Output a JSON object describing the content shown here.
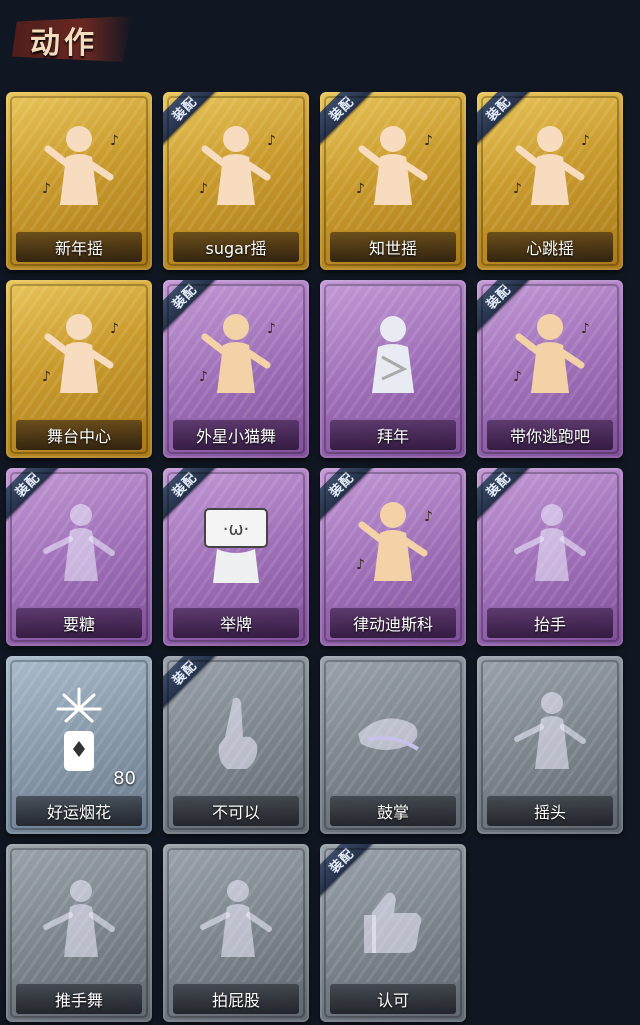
{
  "header": {
    "title": "动作"
  },
  "equip_label": "装配",
  "cards": [
    {
      "label": "新年摇",
      "rarity": "gold",
      "equipped": false,
      "icon": "dancer-icon",
      "count": ""
    },
    {
      "label": "sugar摇",
      "rarity": "gold",
      "equipped": true,
      "icon": "dancer-icon",
      "count": ""
    },
    {
      "label": "知世摇",
      "rarity": "gold",
      "equipped": true,
      "icon": "dancer-icon",
      "count": ""
    },
    {
      "label": "心跳摇",
      "rarity": "gold",
      "equipped": true,
      "icon": "dancer-icon",
      "count": ""
    },
    {
      "label": "舞台中心",
      "rarity": "gold",
      "equipped": false,
      "icon": "dancer-icon",
      "count": ""
    },
    {
      "label": "外星小猫舞",
      "rarity": "purple",
      "equipped": true,
      "icon": "dancer-icon",
      "count": ""
    },
    {
      "label": "拜年",
      "rarity": "purple",
      "equipped": false,
      "icon": "bow-icon",
      "count": ""
    },
    {
      "label": "带你逃跑吧",
      "rarity": "purple",
      "equipped": true,
      "icon": "dancer-icon",
      "count": ""
    },
    {
      "label": "要糖",
      "rarity": "purple",
      "equipped": true,
      "icon": "ghost-figure-icon",
      "count": ""
    },
    {
      "label": "举牌",
      "rarity": "purple",
      "equipped": true,
      "icon": "sign-holder-icon",
      "count": ""
    },
    {
      "label": "律动迪斯科",
      "rarity": "purple",
      "equipped": true,
      "icon": "dancer-icon",
      "count": ""
    },
    {
      "label": "抬手",
      "rarity": "purple",
      "equipped": true,
      "icon": "ghost-figure-icon",
      "count": ""
    },
    {
      "label": "好运烟花",
      "rarity": "icy",
      "equipped": false,
      "icon": "firework-icon",
      "count": "80"
    },
    {
      "label": "不可以",
      "rarity": "silver",
      "equipped": true,
      "icon": "finger-icon",
      "count": ""
    },
    {
      "label": "鼓掌",
      "rarity": "silver",
      "equipped": false,
      "icon": "clap-icon",
      "count": ""
    },
    {
      "label": "摇头",
      "rarity": "silver",
      "equipped": false,
      "icon": "ghost-figure-icon",
      "count": ""
    },
    {
      "label": "推手舞",
      "rarity": "silver",
      "equipped": false,
      "icon": "ghost-figure-icon",
      "count": ""
    },
    {
      "label": "拍屁股",
      "rarity": "silver",
      "equipped": false,
      "icon": "ghost-figure-icon",
      "count": ""
    },
    {
      "label": "认可",
      "rarity": "silver",
      "equipped": true,
      "icon": "thumbs-up-icon",
      "count": ""
    }
  ]
}
